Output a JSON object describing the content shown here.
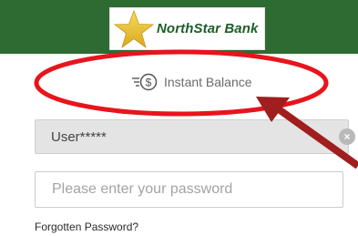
{
  "header": {
    "bank_name": "NorthStar Bank",
    "background_color": "#2e6b32",
    "logo_icon": "star-icon"
  },
  "instant_balance": {
    "icon": "coin-dollar-icon",
    "label": "Instant Balance"
  },
  "login": {
    "username_value": "User*****",
    "password_placeholder": "Please enter your password",
    "forgot_label": "Forgotten Password?"
  },
  "annotation": {
    "ellipse_color": "#e8141c",
    "arrow_color": "#a01e1e"
  }
}
